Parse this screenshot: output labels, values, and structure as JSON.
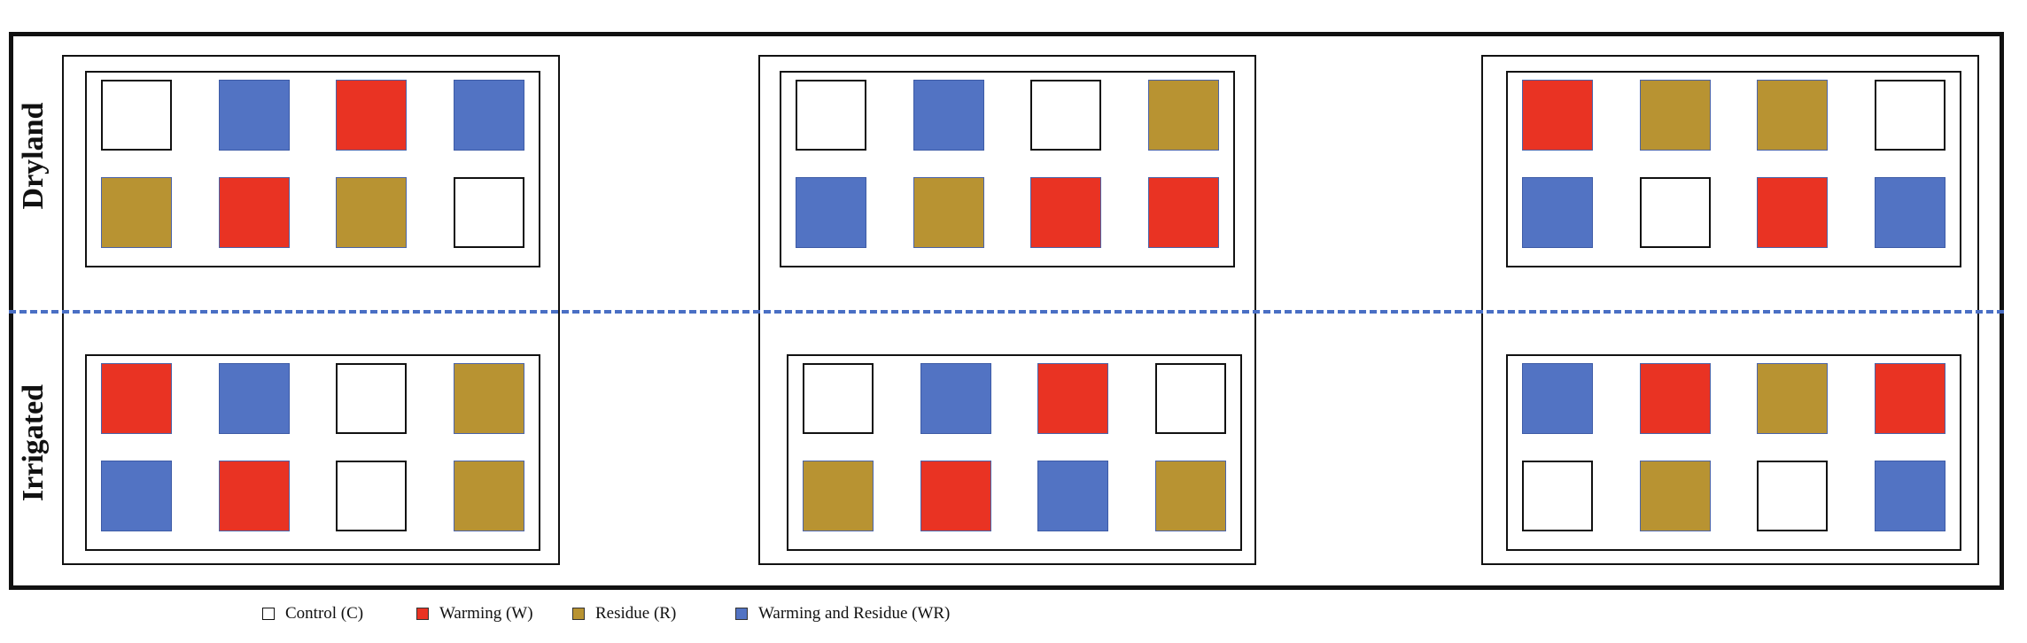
{
  "row_labels": {
    "dryland": "Dryland",
    "irrigated": "Irrigated"
  },
  "legend": [
    {
      "code": "C",
      "label": "Control (C)",
      "color": "#ffffff"
    },
    {
      "code": "W",
      "label": "Warming (W)",
      "color": "#e93323"
    },
    {
      "code": "R",
      "label": "Residue (R)",
      "color": "#b89332"
    },
    {
      "code": "WR",
      "label": "Warming and Residue (WR)",
      "color": "#5273c3"
    }
  ],
  "layout": {
    "dryland": [
      [
        [
          "C",
          "WR",
          "W",
          "WR"
        ],
        [
          "R",
          "W",
          "R",
          "C"
        ]
      ],
      [
        [
          "C",
          "WR",
          "C",
          "R"
        ],
        [
          "WR",
          "R",
          "W",
          "W"
        ]
      ],
      [
        [
          "W",
          "R",
          "R",
          "C"
        ],
        [
          "WR",
          "C",
          "W",
          "WR"
        ]
      ]
    ],
    "irrigated": [
      [
        [
          "W",
          "WR",
          "C",
          "R"
        ],
        [
          "WR",
          "W",
          "C",
          "R"
        ]
      ],
      [
        [
          "C",
          "WR",
          "W",
          "C"
        ],
        [
          "R",
          "W",
          "WR",
          "R"
        ]
      ],
      [
        [
          "WR",
          "W",
          "R",
          "W"
        ],
        [
          "C",
          "R",
          "C",
          "WR"
        ]
      ]
    ]
  }
}
